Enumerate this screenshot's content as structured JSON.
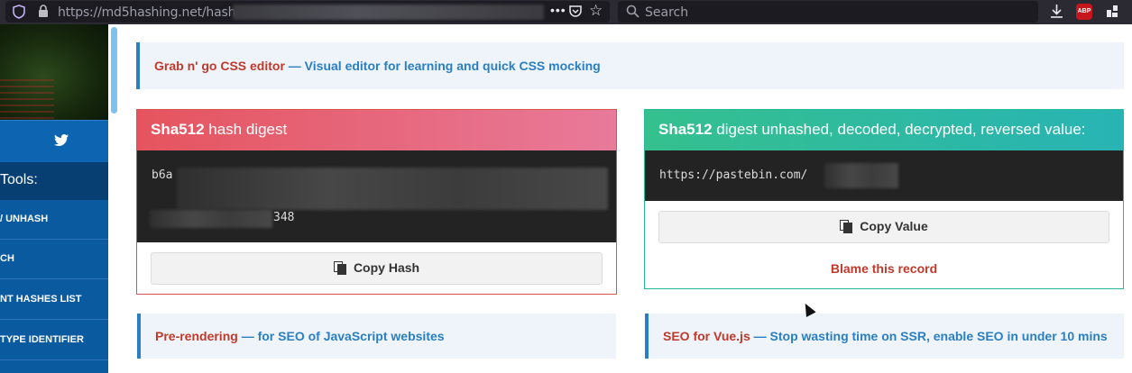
{
  "browser": {
    "url_visible": "https://md5hashing.net/hash/",
    "search_placeholder": "Search",
    "abp_label": "ABP"
  },
  "sidebar": {
    "tools_label": "Tools:",
    "items": [
      {
        "label": "/ UNHASH"
      },
      {
        "label": "CH"
      },
      {
        "label": "NT HASHES LIST"
      },
      {
        "label": "TYPE IDENTIFIER"
      }
    ]
  },
  "ads": {
    "top": {
      "name": "Grab n' go CSS editor",
      "desc": " — Visual editor for learning and quick CSS mocking"
    },
    "bottom_left": {
      "name": "Pre-rendering",
      "desc": " — for SEO of JavaScript websites"
    },
    "bottom_right": {
      "name": "SEO for Vue.js",
      "desc": " — Stop wasting time on SSR, enable SEO in under 10 mins"
    }
  },
  "hash_panel": {
    "algo": "Sha512",
    "title_rest": " hash digest",
    "hash_start": "b6a",
    "hash_end": "348",
    "copy_label": "Copy Hash",
    "color": "#e05a63"
  },
  "value_panel": {
    "algo": "Sha512",
    "title_rest": " digest unhashed, decoded, decrypted, reversed value:",
    "value_prefix": "https://pastebin.com/",
    "copy_label": "Copy Value",
    "blame_label": "Blame this record",
    "color": "#2ab89a"
  }
}
